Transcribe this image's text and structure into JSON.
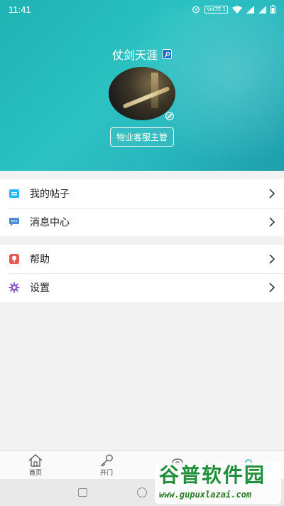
{
  "status_bar": {
    "time": "11:41",
    "lte_label": "VoLTE 1"
  },
  "profile": {
    "name": "仗剑天涯",
    "role": "物业客服主管"
  },
  "menu_group_1": [
    {
      "label": "我的帖子",
      "icon": "posts-icon"
    },
    {
      "label": "消息中心",
      "icon": "message-icon"
    }
  ],
  "menu_group_2": [
    {
      "label": "帮助",
      "icon": "help-icon"
    },
    {
      "label": "设置",
      "icon": "gear-icon"
    }
  ],
  "bottom_nav": [
    {
      "label": "首页",
      "icon": "home-icon"
    },
    {
      "label": "开门",
      "icon": "key-icon"
    },
    {
      "label": "",
      "icon": "location-icon"
    },
    {
      "label": "",
      "icon": "user-icon"
    }
  ],
  "watermark": {
    "title": "谷普软件园",
    "url": "www.gupuxlazai.com"
  },
  "colors": {
    "header": "#2cc2c2",
    "posts": "#29b6f6",
    "message": "#4a90d9",
    "help": "#e8574f",
    "settings": "#8a5cc6"
  }
}
